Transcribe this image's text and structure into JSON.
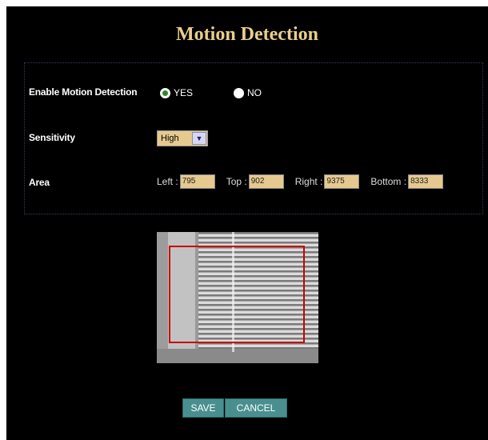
{
  "title": "Motion Detection",
  "enable": {
    "label": "Enable Motion Detection",
    "yes_label": "YES",
    "no_label": "NO",
    "selected": "YES"
  },
  "sensitivity": {
    "label": "Sensitivity",
    "value": "High"
  },
  "area": {
    "label": "Area",
    "left_label": "Left :",
    "left_value": "795",
    "top_label": "Top :",
    "top_value": "902",
    "right_label": "Right :",
    "right_value": "9375",
    "bottom_label": "Bottom :",
    "bottom_value": "8333"
  },
  "buttons": {
    "save": "SAVE",
    "cancel": "CANCEL"
  },
  "colors": {
    "background": "#000000",
    "title": "#e8cf8c",
    "input_fill": "#e6c98e",
    "button": "#4a8f8f",
    "detection_box": "#cc0000"
  }
}
